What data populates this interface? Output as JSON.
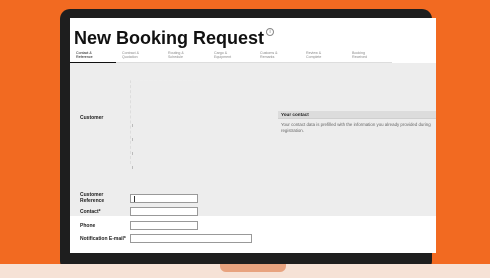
{
  "page": {
    "title": "New Booking Request",
    "title_icon": "info-icon"
  },
  "steps": [
    {
      "line1": "Contact &",
      "line2": "Reference",
      "active": true
    },
    {
      "line1": "Contract &",
      "line2": "Quotation",
      "active": false
    },
    {
      "line1": "Routing &",
      "line2": "Schedule",
      "active": false
    },
    {
      "line1": "Cargo &",
      "line2": "Equipment",
      "active": false
    },
    {
      "line1": "Customs &",
      "line2": "Remarks",
      "active": false
    },
    {
      "line1": "Review &",
      "line2": "Complete",
      "active": false
    },
    {
      "line1": "Booking",
      "line2": "Received",
      "active": false
    }
  ],
  "form": {
    "customer_label": "Customer",
    "customer_ref_label_1": "Customer",
    "customer_ref_label_2": "Reference",
    "contact_label": "Contact*",
    "phone_label": "Phone",
    "email_label": "Notification E-mail*",
    "customer_ref_value": "",
    "contact_value": "",
    "phone_value": "",
    "email_value": ""
  },
  "info": {
    "header": "Your contact",
    "text": "Your contact data is prefilled with the information you already provided during registration."
  },
  "colors": {
    "background": "#f26a21",
    "panel": "#ededed"
  }
}
